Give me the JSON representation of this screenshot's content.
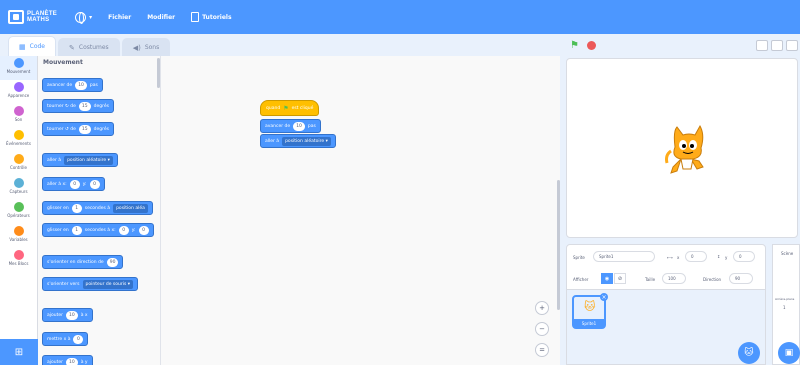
{
  "menubar": {
    "logo_line1": "PLANÈTE",
    "logo_line2": "MATHS",
    "file_label": "Fichier",
    "edit_label": "Modifier",
    "tutorials_label": "Tutoriels"
  },
  "tabs": [
    {
      "label": "Code"
    },
    {
      "label": "Costumes"
    },
    {
      "label": "Sons"
    }
  ],
  "categories": [
    {
      "label": "Mouvement",
      "color": "#4c97ff"
    },
    {
      "label": "Apparence",
      "color": "#9966ff"
    },
    {
      "label": "Son",
      "color": "#cf63cf"
    },
    {
      "label": "Événements",
      "color": "#ffbf00"
    },
    {
      "label": "Contrôle",
      "color": "#ffab19"
    },
    {
      "label": "Capteurs",
      "color": "#5cb1d6"
    },
    {
      "label": "Opérateurs",
      "color": "#59c059"
    },
    {
      "label": "Variables",
      "color": "#ff8c1a"
    },
    {
      "label": "Mes Blocs",
      "color": "#ff6680"
    }
  ],
  "palette": {
    "title": "Mouvement",
    "blocks": [
      {
        "a": "avancer de",
        "v1": "10",
        "b": "pas"
      },
      {
        "a": "tourner ↻ de",
        "v1": "15",
        "b": "degrés"
      },
      {
        "a": "tourner ↺ de",
        "v1": "15",
        "b": "degrés"
      },
      {
        "a": "aller à",
        "dd": "position aléatoire ▾"
      },
      {
        "a": "aller à x:",
        "v1": "0",
        "b": "y:",
        "v2": "0"
      },
      {
        "a": "glisser en",
        "v1": "1",
        "b": "secondes à",
        "dd": "position aléa"
      },
      {
        "a": "glisser en",
        "v1": "1",
        "b": "secondes à x:",
        "v2": "0",
        "c": "y:",
        "v3": "0"
      },
      {
        "a": "s'orienter en direction de",
        "v1": "90"
      },
      {
        "a": "s'orienter vers",
        "dd": "pointeur de souris ▾"
      },
      {
        "a": "ajouter",
        "v1": "10",
        "b": "à x"
      },
      {
        "a": "mettre x à",
        "v1": "0"
      },
      {
        "a": "ajouter",
        "v1": "10",
        "b": "à y"
      }
    ]
  },
  "script": {
    "hat": "quand",
    "hat_b": "est cliqué",
    "b1_a": "avancer de",
    "b1_v": "10",
    "b1_b": "pas",
    "b2_a": "aller à",
    "b2_dd": "position aléatoire ▾"
  },
  "zoom": {
    "in": "+",
    "out": "−",
    "reset": "="
  },
  "sprite_info": {
    "sprite_label": "Sprite",
    "sprite_name": "Sprite1",
    "x_label": "x",
    "x_value": "0",
    "y_label": "y",
    "y_value": "0",
    "show_label": "Afficher",
    "size_label": "Taille",
    "size_value": "100",
    "direction_label": "Direction",
    "direction_value": "90"
  },
  "sprite_list": {
    "thumb_label": "Sprite1"
  },
  "backdrop": {
    "label": "Scène",
    "count_label": "Arrière-plans",
    "count": "1"
  },
  "colors": {
    "accent": "#4c97ff",
    "events": "#ffbf00"
  }
}
